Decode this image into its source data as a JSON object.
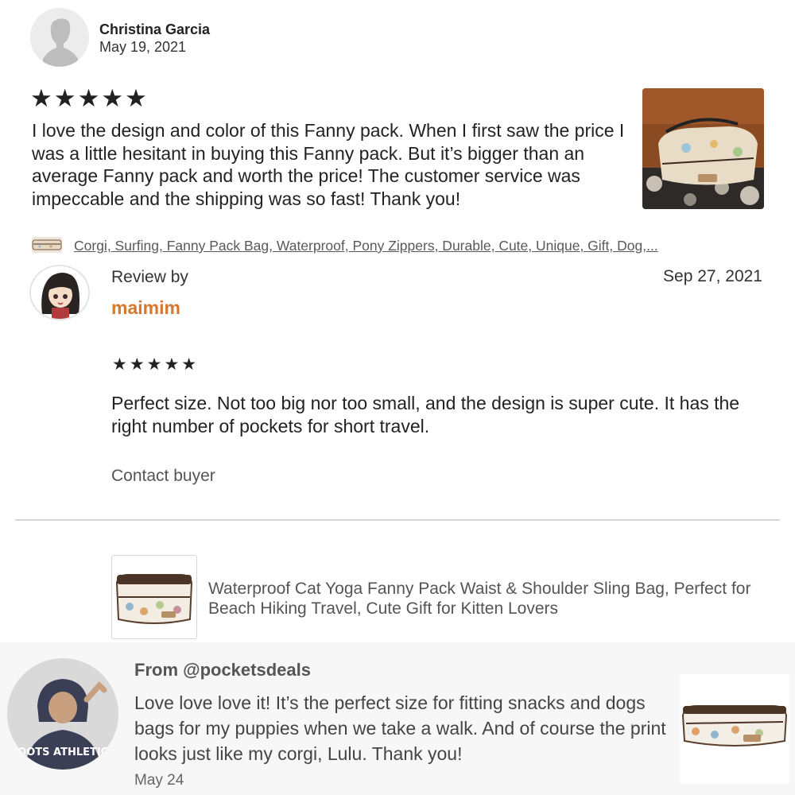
{
  "review1": {
    "author": "Christina Garcia",
    "date": "May 19, 2021",
    "stars": "★★★★★",
    "rating": 5,
    "text": "I love the design and color of this Fanny pack. When I first saw the price I was a little hesitant in buying this Fanny pack. But it’s bigger than an average Fanny pack and worth the price!  The customer service was impeccable and the shipping was so fast!  Thank you!",
    "item_tags": "Corgi, Surfing, Fanny Pack Bag, Waterproof, Pony Zippers, Durable, Cute, Unique, Gift, Dog,..."
  },
  "review2": {
    "label": "Review by",
    "username": "maimim",
    "date": "Sep 27, 2021",
    "stars": "★★★★★",
    "rating": 5,
    "text": "Perfect size. Not too big nor too small, and the design is super cute. It has the right number of pockets for short travel.",
    "contact_label": "Contact buyer",
    "username_color": "#d5772d"
  },
  "product": {
    "title": "Waterproof Cat Yoga Fanny Pack Waist & Shoulder Sling Bag, Perfect for Beach Hiking Travel, Cute Gift for Kitten Lovers"
  },
  "review3": {
    "from": "From @pocketsdeals",
    "text": "Love love love it! It’s the perfect size for fitting snacks and dogs bags for my puppies when we take a walk. And of course the print looks just like my corgi, Lulu. Thank you!",
    "date": "May 24",
    "avatar_shirt_text": "ROOTS ATHLETICS"
  }
}
